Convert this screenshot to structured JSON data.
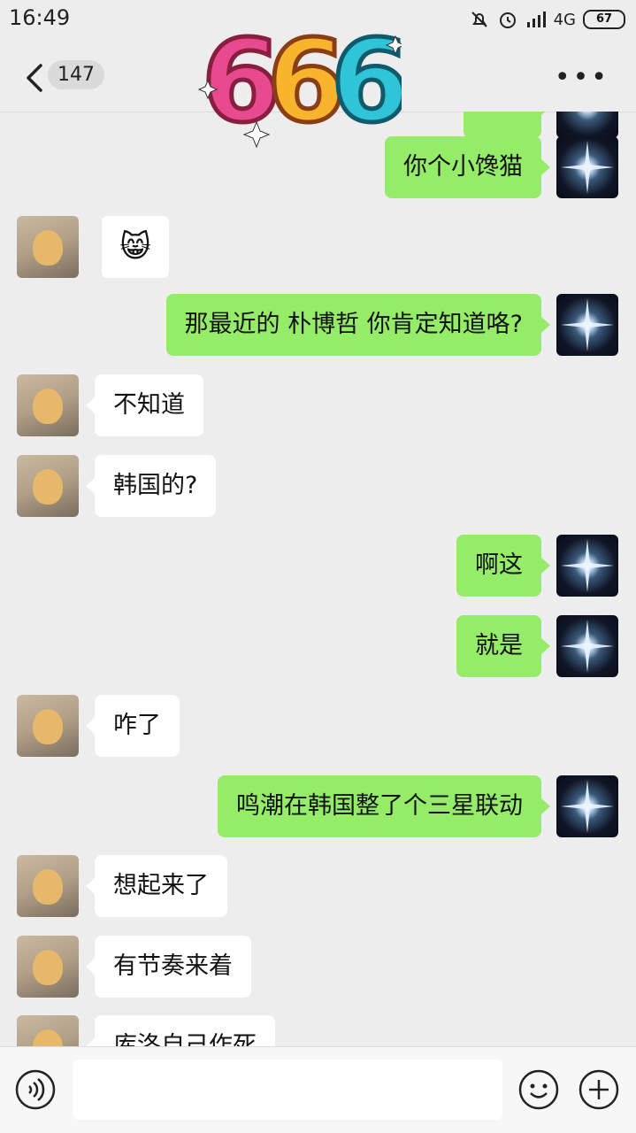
{
  "status_bar": {
    "time": "16:49",
    "network": "4G",
    "battery": "67"
  },
  "header": {
    "unread_count": "147",
    "sticker_text": "666"
  },
  "messages": [
    {
      "from": "me",
      "text": "你个小馋猫"
    },
    {
      "from": "other",
      "text": "😸",
      "type": "emoji"
    },
    {
      "from": "me",
      "text": "那最近的 朴博哲 你肯定知道咯?"
    },
    {
      "from": "other",
      "text": "不知道"
    },
    {
      "from": "other",
      "text": "韩国的?"
    },
    {
      "from": "me",
      "text": "啊这"
    },
    {
      "from": "me",
      "text": "就是"
    },
    {
      "from": "other",
      "text": "咋了"
    },
    {
      "from": "me",
      "text": "鸣潮在韩国整了个三星联动"
    },
    {
      "from": "other",
      "text": "想起来了"
    },
    {
      "from": "other",
      "text": "有节奏来着"
    },
    {
      "from": "other",
      "text": "库洛自己作死"
    }
  ],
  "colors": {
    "outgoing_bubble": "#95ec69",
    "incoming_bubble": "#ffffff",
    "background": "#ededed"
  }
}
